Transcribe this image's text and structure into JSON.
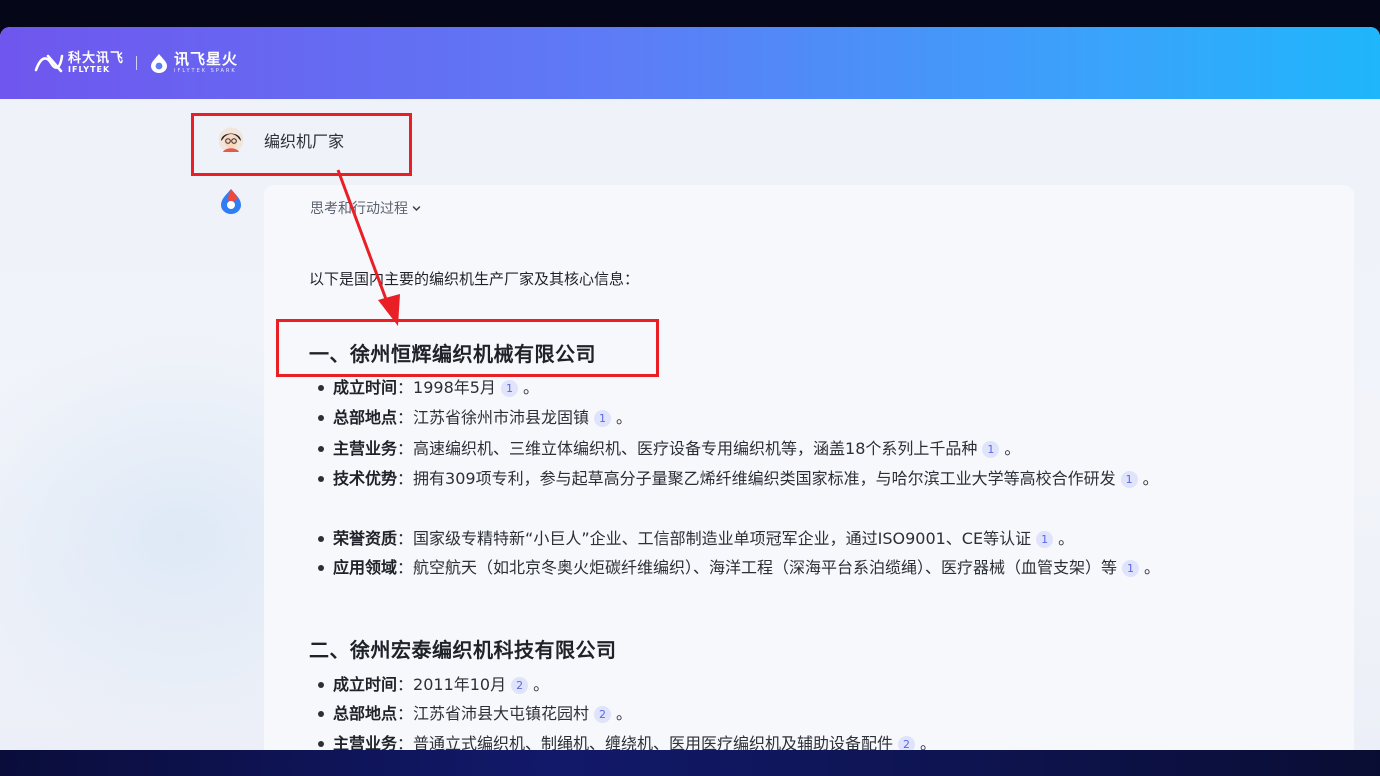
{
  "header": {
    "brand_iflytek_cn": "科大讯飞",
    "brand_iflytek_en": "IFLYTEK",
    "brand_spark_cn": "讯飞星火",
    "brand_spark_en": "IFLYTEK SPARK"
  },
  "conversation": {
    "user_message": "编织机厂家",
    "thinking_label": "思考和行动过程",
    "intro": "以下是国内主要的编织机生产厂家及其核心信息：",
    "sections": [
      {
        "title": "一、徐州恒辉编织机械有限公司",
        "items": [
          {
            "key": "成立时间",
            "sep": "：",
            "text": "1998年5月",
            "cite": "1",
            "end": "。"
          },
          {
            "key": "总部地点",
            "sep": "：",
            "text": "江苏省徐州市沛县龙固镇",
            "cite": "1",
            "end": "。"
          },
          {
            "key": "主营业务",
            "sep": "：",
            "text": "高速编织机、三维立体编织机、医疗设备专用编织机等，涵盖18个系列上千品种",
            "cite": "1",
            "end": "。"
          },
          {
            "key": "技术优势",
            "sep": "：",
            "text": "拥有309项专利，参与起草高分子量聚乙烯纤维编织类国家标准，与哈尔滨工业大学等高校合作研发",
            "cite": "1",
            "end": "。"
          },
          {
            "key": "荣誉资质",
            "sep": "：",
            "text": "国家级专精特新“小巨人”企业、工信部制造业单项冠军企业，通过ISO9001、CE等认证",
            "cite": "1",
            "end": "。"
          },
          {
            "key": "应用领域",
            "sep": "：",
            "text": "航空航天（如北京冬奥火炬碳纤维编织）、海洋工程（深海平台系泊缆绳）、医疗器械（血管支架）等",
            "cite": "1",
            "end": "。"
          }
        ]
      },
      {
        "title": "二、徐州宏泰编织机科技有限公司",
        "items": [
          {
            "key": "成立时间",
            "sep": "：",
            "text": "2011年10月",
            "cite": "2",
            "end": "。"
          },
          {
            "key": "总部地点",
            "sep": "：",
            "text": "江苏省沛县大屯镇花园村",
            "cite": "2",
            "end": "。"
          },
          {
            "key": "主营业务",
            "sep": "：",
            "text": "普通立式编织机、制绳机、缠绕机、医用医疗编织机及辅助设备配件",
            "cite": "2",
            "end": "。"
          }
        ]
      }
    ]
  },
  "colors": {
    "annotation_red": "#ea1f25",
    "header_gradient_start": "#6f56ee",
    "header_gradient_end": "#1fb6fb",
    "citation_badge": "#5b67e6"
  },
  "icons": [
    "iflytek-logo-icon",
    "spark-logo-icon",
    "user-avatar-icon",
    "spark-bot-icon",
    "chevron-down-icon",
    "annotation-arrow"
  ]
}
